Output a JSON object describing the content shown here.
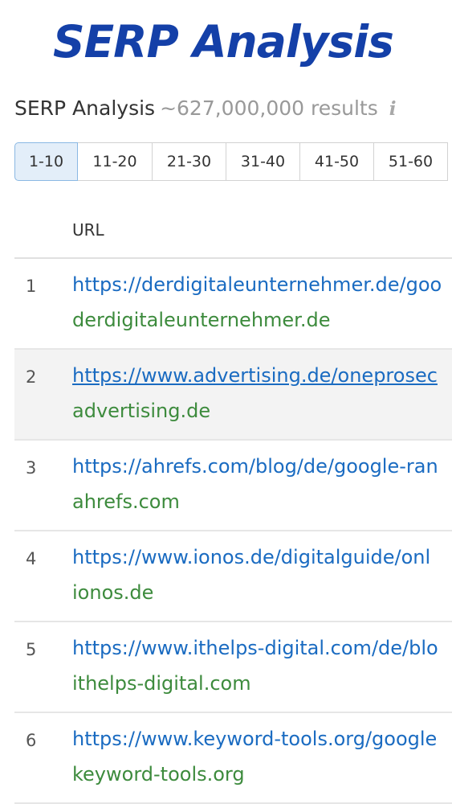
{
  "banner": {
    "title": "SERP Analysis"
  },
  "header": {
    "title": "SERP Analysis",
    "results": "~627,000,000 results",
    "info_icon": "i"
  },
  "pagination": {
    "pages": [
      "1-10",
      "11-20",
      "21-30",
      "31-40",
      "41-50",
      "51-60"
    ],
    "active": "1-10"
  },
  "table": {
    "columns": {
      "url": "URL"
    },
    "rows": [
      {
        "num": "1",
        "url": "https://derdigitaleunternehmer.de/goo",
        "domain": "derdigitaleunternehmer.de"
      },
      {
        "num": "2",
        "url": "https://www.advertising.de/oneprosec",
        "domain": "advertising.de"
      },
      {
        "num": "3",
        "url": "https://ahrefs.com/blog/de/google-ran",
        "domain": "ahrefs.com"
      },
      {
        "num": "4",
        "url": "https://www.ionos.de/digitalguide/onl",
        "domain": "ionos.de"
      },
      {
        "num": "5",
        "url": "https://www.ithelps-digital.com/de/blo",
        "domain": "ithelps-digital.com"
      },
      {
        "num": "6",
        "url": "https://www.keyword-tools.org/google",
        "domain": "keyword-tools.org"
      }
    ]
  },
  "colors": {
    "banner": "#1440a8",
    "link": "#1a6bc1",
    "domain": "#3d8b3d",
    "active_page_bg": "#e3eef9",
    "active_page_border": "#8ab8e3"
  }
}
